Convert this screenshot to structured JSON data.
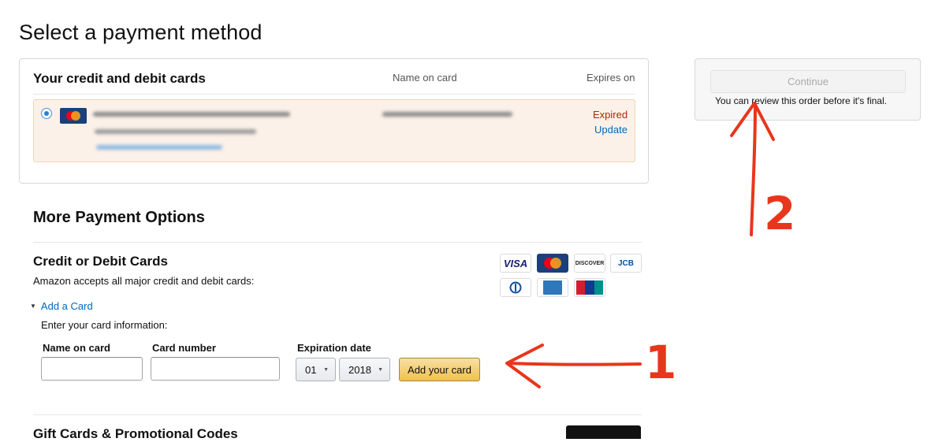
{
  "page": {
    "title": "Select a payment method"
  },
  "saved_cards": {
    "heading": "Your credit and debit cards",
    "columns": {
      "name": "Name on card",
      "expires": "Expires on"
    },
    "card": {
      "status": "Expired",
      "update_link": "Update",
      "logo_icon": "mastercard-icon"
    }
  },
  "continue_box": {
    "button_label": "Continue",
    "note": "You can review this order before it's final."
  },
  "more_options": {
    "heading": "More Payment Options",
    "credit_debit": {
      "heading": "Credit or Debit Cards",
      "subtext": "Amazon accepts all major credit and debit cards:",
      "add_card_toggle": "Add a Card",
      "enter_info": "Enter your card information:",
      "fields": {
        "name_label": "Name on card",
        "name_value": "",
        "number_label": "Card number",
        "number_value": "",
        "expiration_label": "Expiration date",
        "month_value": "01",
        "year_value": "2018"
      },
      "add_button": "Add your card",
      "network_logos": [
        "visa-logo",
        "mastercard-logo",
        "discover-logo",
        "jcb-logo",
        "diners-club-logo",
        "american-express-logo",
        "unionpay-logo"
      ]
    },
    "gift_cards": {
      "heading": "Gift Cards & Promotional Codes"
    }
  },
  "logos": {
    "visa": "VISA",
    "mastercard": "MasterCard",
    "discover": "DISCOVER",
    "jcb": "JCB",
    "diners": "Diners Club",
    "unionpay": "UnionPay"
  },
  "annotations": {
    "arrow_1_label": "1",
    "arrow_2_label": "2"
  },
  "colors": {
    "accent_link": "#0066c0",
    "expired_red": "#b12704",
    "annotation_red": "#e8361c",
    "button_gold": "#f0c14b"
  }
}
